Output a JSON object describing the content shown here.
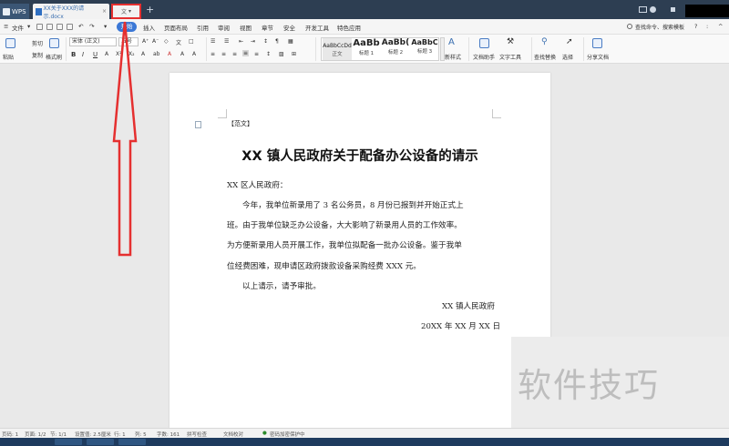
{
  "titlebar": {
    "app_label": "WPS",
    "doc_tab": "XX关于XXX的请示.docx",
    "active_tab": "文",
    "new_tab": "+"
  },
  "menu": {
    "file": "文件",
    "start": "开始",
    "items": [
      "插入",
      "页面布局",
      "引用",
      "审阅",
      "视图",
      "章节",
      "安全",
      "开发工具",
      "特色应用"
    ],
    "search": "查找命令、搜索模板",
    "help": "?"
  },
  "ribbon": {
    "paste": "粘贴",
    "cut": "剪切",
    "copy": "复制",
    "format_painter": "格式刷",
    "font_name": "宋体 (正文)",
    "font_size": "五号",
    "bold": "B",
    "italic": "I",
    "underline": "U",
    "styles": [
      {
        "sample": "AaBbCcDd",
        "name": "正文"
      },
      {
        "sample": "AaBb",
        "name": "标题 1"
      },
      {
        "sample": "AaBb(",
        "name": "标题 2"
      },
      {
        "sample": "AaBbC",
        "name": "标题 3"
      }
    ],
    "new_style": "新样式",
    "doc_assistant": "文档助手",
    "text_tools": "文字工具",
    "find_replace": "查找替换",
    "select": "选择",
    "share_doc": "分享文档"
  },
  "document": {
    "tag": "【范文】",
    "title": "XX 镇人民政府关于配备办公设备的请示",
    "salutation": "XX 区人民政府：",
    "lines": [
      "今年，我单位新录用了 3 名公务员，8 月份已报到并开始正式上",
      "班。由于我单位缺乏办公设备，大大影响了新录用人员的工作效率。",
      "为方便新录用人员开展工作，我单位拟配备一批办公设备。鉴于我单",
      "位经费困难，现申请区政府拨款设备采购经费 XXX 元。"
    ],
    "closing": "以上请示，请予审批。",
    "signature": "XX 镇人民政府",
    "date": "20XX 年 XX 月 XX 日"
  },
  "watermark": "软件技巧",
  "status": {
    "page_no": "页码: 1",
    "pages": "页面: 1/2",
    "section": "节: 1/1",
    "setting": "设置值: 2.5厘米",
    "row": "行: 1",
    "col": "列: 5",
    "words": "字数: 161",
    "spell": "拼写检查",
    "proof": "文档校对",
    "protect": "密码加密保护中"
  },
  "colors": {
    "accent": "#3b78d6",
    "highlight": "#e53030",
    "titlebar": "#2d3e52"
  }
}
